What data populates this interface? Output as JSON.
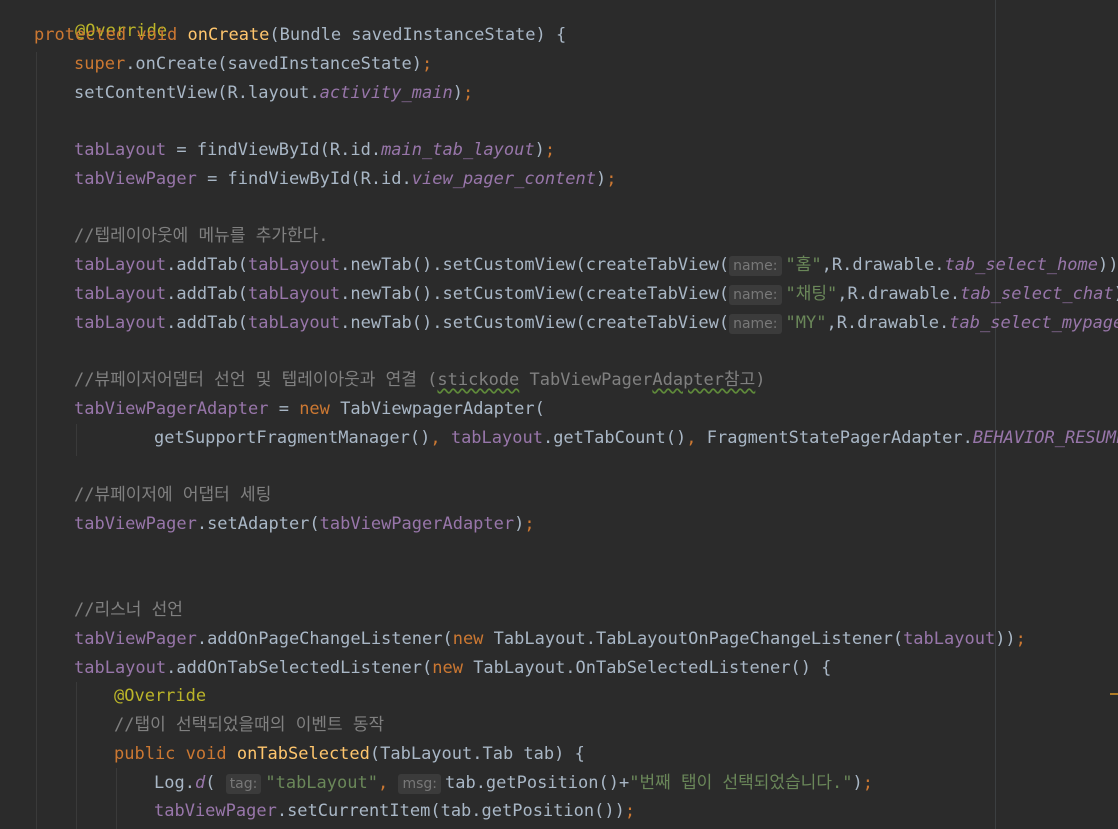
{
  "code": {
    "l1": "@Override",
    "l2_kw": "protected void ",
    "l2_fn": "onCreate",
    "l2_rest": "(Bundle savedInstanceState) {",
    "l3_super": "super",
    "l3_rest": ".onCreate(savedInstanceState)",
    "l4_a": "setContentView(R.layout.",
    "l4_b": "activity_main",
    "l4_c": ")",
    "l5_f": "tabLayout",
    "l5_a": " = findViewById(R.id.",
    "l5_b": "main_tab_layout",
    "l5_c": ")",
    "l6_f": "tabViewPager",
    "l6_a": " = findViewById(R.id.",
    "l6_b": "view_pager_content",
    "l6_c": ")",
    "c1": "//텝레이아웃에 메뉴를 추가한다.",
    "tab_f": "tabLayout",
    "tab_a": ".addTab(",
    "tab_b": ".newTab().setCustomView(createTabView(",
    "hint_name": "name:",
    "t1_str": "\"홈\"",
    "t1_a": ",R.drawable.",
    "t1_b": "tab_select_home",
    "t1_c": ")))",
    "t2_str": "\"채팅\"",
    "t2_b": "tab_select_chat",
    "t2_c": ")",
    "t3_str": "\"MY\"",
    "t3_b": "tab_select_mypage",
    "t3_c": ")",
    "c2_a": "//뷰페이저어뎁터 선언 및 텝레이아웃과 연결 (",
    "c2_b": "stickode",
    "c2_c": " TabViewPager",
    "c2_d": "Adapter참고",
    "c2_e": ")",
    "l9_f": "tabViewPagerAdapter",
    "l9_a": " = ",
    "l9_new": "new ",
    "l9_b": "TabViewpagerAdapter(",
    "l10_a": "getSupportFragmentManager()",
    "l10_b": ", ",
    "l10_f": "tabLayout",
    "l10_c": ".getTabCount()",
    "l10_d": ", ",
    "l10_e": "FragmentStatePagerAdapter.",
    "l10_g": "BEHAVIOR_RESUME_CURRENT_FRAGMENT",
    "c3": "//뷰페이저에 어댑터 세팅",
    "l11_f": "tabViewPager",
    "l11_a": ".setAdapter(",
    "l11_b": "tabViewPagerAdapter",
    "l11_c": ")",
    "c4": "//리스너 선언",
    "l12_f": "tabViewPager",
    "l12_a": ".addOnPageChangeListener(",
    "l12_new": "new ",
    "l12_b": "TabLayout.TabLayoutOnPageChangeListener(",
    "l12_c": "tabLayout",
    "l12_d": "))",
    "l13_f": "tabLayout",
    "l13_a": ".addOnTabSelectedListener(",
    "l13_new": "new ",
    "l13_b": "TabLayout.OnTabSelectedListener() {",
    "l14": "@Override",
    "c5": "//탭이 선택되었을때의 이벤트 동작",
    "l15_kw": "public void ",
    "l15_fn": "onTabSelected",
    "l15_rest": "(TabLayout.Tab tab) {",
    "l16_a": "Log.",
    "l16_d": "d",
    "l16_b": "( ",
    "hint_tag": "tag:",
    "l16_str1": "\"tabLayout\"",
    "l16_comma": ", ",
    "hint_msg": "msg:",
    "l16_c": "tab.getPosition()+",
    "l16_str2": "\"번째 탭이 선택되었습니다.\"",
    "l16_e": ")",
    "l17_f": "tabViewPager",
    "l17_a": ".setCurrentItem(tab.getPosition())",
    "semi": ";",
    "comma": ","
  }
}
